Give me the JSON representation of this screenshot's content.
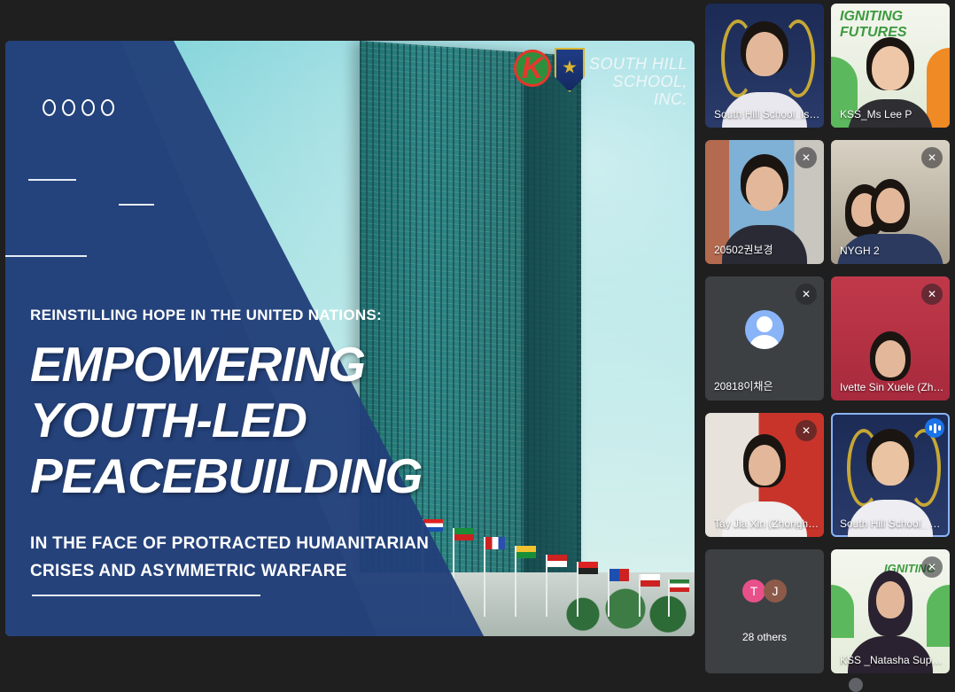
{
  "slide": {
    "top_line": "REINSTILLING HOPE IN THE UNITED NATIONS:",
    "headline_1": "EMPOWERING",
    "headline_2": "YOUTH-LED",
    "headline_3": "PEACEBUILDING",
    "sub_line_1": "IN THE FACE OF PROTRACTED HUMANITARIAN",
    "sub_line_2": "CRISES AND ASYMMETRIC WARFARE",
    "school_name_1": "SOUTH HILL",
    "school_name_2": "SCHOOL, INC.",
    "k_logo": "K",
    "colors": {
      "panel": "#223f7a",
      "sky": "#7fd3d9"
    }
  },
  "participants": [
    {
      "name": "South Hill School_Isa...",
      "muted": false,
      "icon": "none"
    },
    {
      "name": "KSS_Ms Lee P",
      "muted": false,
      "icon": "none",
      "banner": "IGNITING FUTURES"
    },
    {
      "name": "20502권보경",
      "muted": true,
      "icon": "mic-off-icon"
    },
    {
      "name": "NYGH 2",
      "muted": true,
      "icon": "mic-off-icon"
    },
    {
      "name": "20818이채은",
      "muted": true,
      "icon": "mic-off-icon"
    },
    {
      "name": "Ivette Sin Xuele (Zhon...",
      "muted": true,
      "icon": "mic-off-icon"
    },
    {
      "name": "Tay Jia Xin (Zhonghua...",
      "muted": true,
      "icon": "mic-off-icon"
    },
    {
      "name": "South Hill School_ Eri...",
      "muted": false,
      "icon": "speaking-icon",
      "active": true
    },
    {
      "name": "28 others",
      "initials": [
        "T",
        "J"
      ],
      "icon": "none"
    },
    {
      "name": "KSS _Natasha Supaat",
      "muted": true,
      "icon": "mic-off-icon",
      "banner": "IGNITING"
    }
  ],
  "mic_glyph": "✕",
  "accent_color": "#8ab4f8"
}
